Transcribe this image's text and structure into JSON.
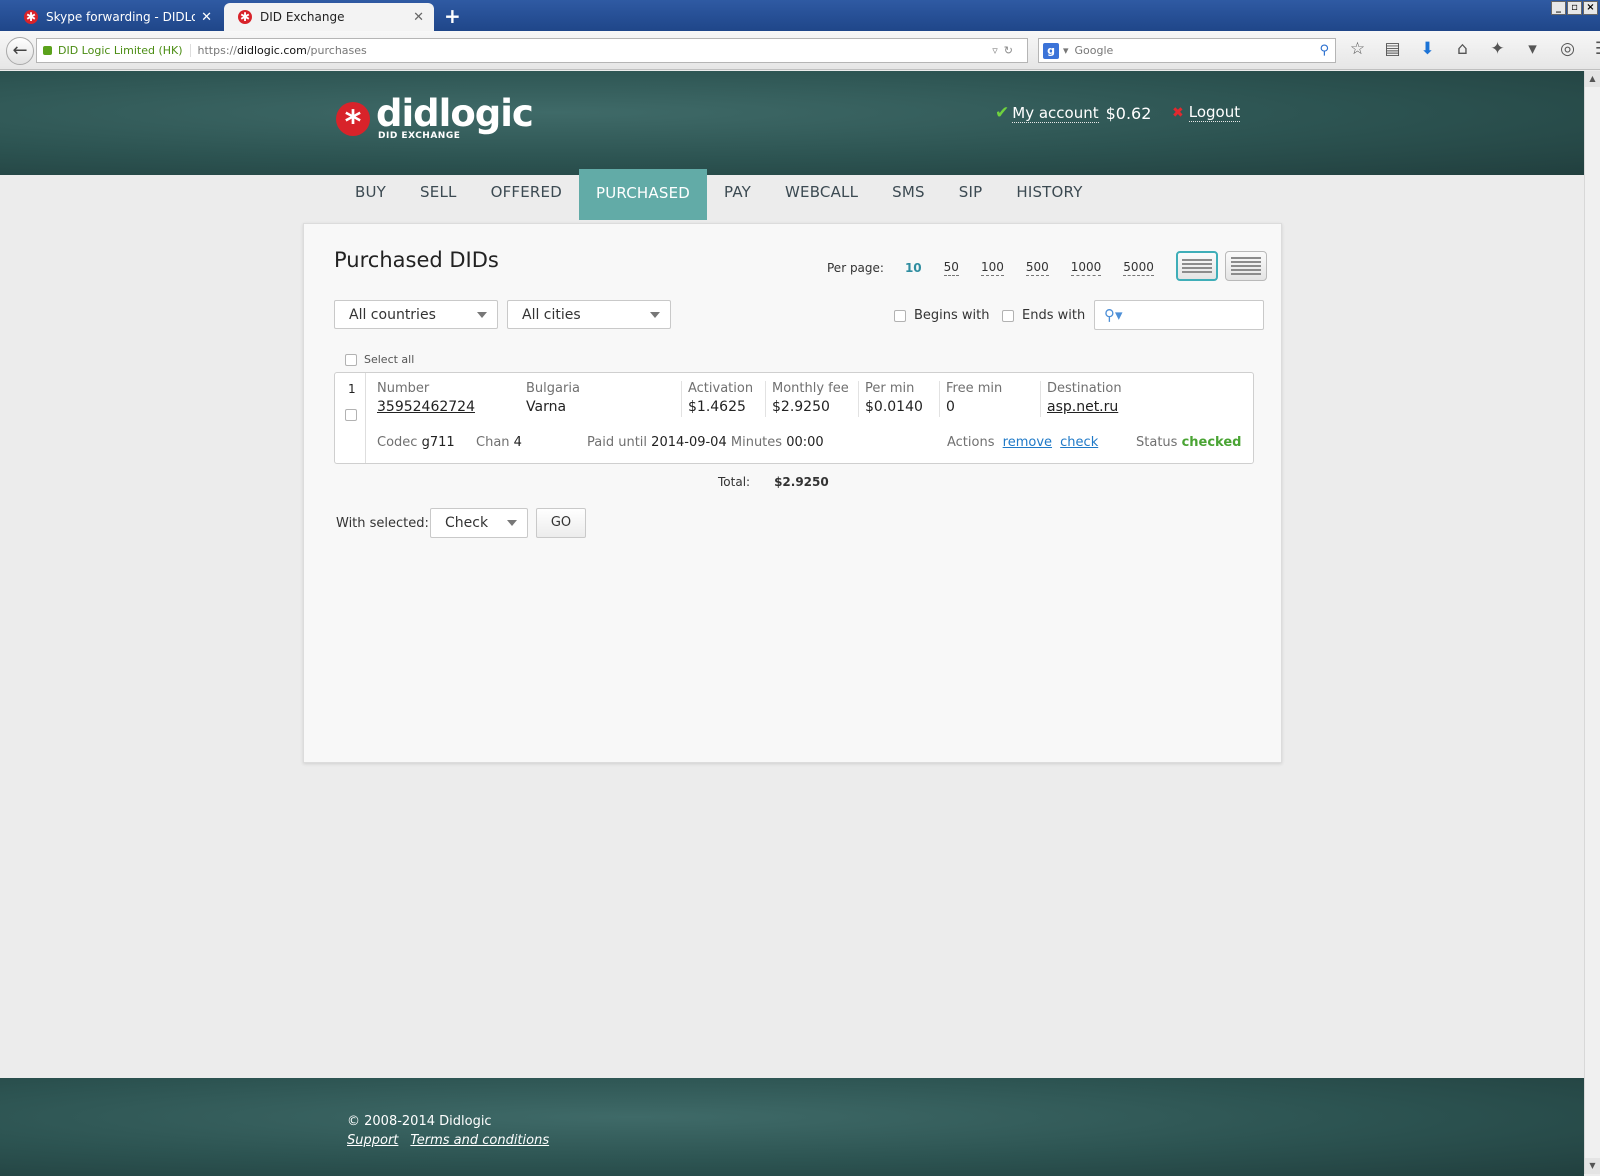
{
  "browser": {
    "tabs": [
      {
        "title": "Skype forwarding - DIDLogic",
        "active": false
      },
      {
        "title": "DID Exchange",
        "active": true
      }
    ],
    "new_tab": "+",
    "identity": "DID Logic Limited (HK)",
    "url_prefix": "https://",
    "url_domain": "didlogic.com",
    "url_path": "/purchases",
    "search_engine_letter": "g",
    "search_placeholder": "Google",
    "window_controls": [
      "_",
      "▫",
      "×"
    ]
  },
  "header": {
    "logo_mark": "*",
    "logo_name": "didlogic",
    "logo_sub": "DID EXCHANGE",
    "account_label": "My account",
    "balance": "$0.62",
    "logout_label": "Logout"
  },
  "nav": {
    "items": [
      "BUY",
      "SELL",
      "OFFERED",
      "PURCHASED",
      "PAY",
      "WEBCALL",
      "SMS",
      "SIP",
      "HISTORY"
    ],
    "active": "PURCHASED"
  },
  "panel": {
    "title": "Purchased DIDs",
    "per_page_label": "Per page:",
    "per_page_options": [
      "10",
      "50",
      "100",
      "500",
      "1000",
      "5000"
    ],
    "per_page_current": "10",
    "country_select": "All countries",
    "city_select": "All cities",
    "begins_with": "Begins with",
    "ends_with": "Ends with",
    "select_all": "Select all",
    "rows": [
      {
        "index": "1",
        "number_label": "Number",
        "number": "35952462724",
        "country": "Bulgaria",
        "city": "Varna",
        "activation_label": "Activation",
        "activation": "$1.4625",
        "monthly_label": "Monthly fee",
        "monthly": "$2.9250",
        "permin_label": "Per min",
        "permin": "$0.0140",
        "freemin_label": "Free min",
        "freemin": "0",
        "destination_label": "Destination",
        "destination": "asp.net.ru",
        "codec_label": "Codec",
        "codec": "g711",
        "chan_label": "Chan",
        "chan": "4",
        "paid_label": "Paid until",
        "paid_until": "2014-09-04",
        "minutes_label": "Minutes",
        "minutes": "00:00",
        "actions_label": "Actions",
        "action_remove": "remove",
        "action_check": "check",
        "status_label": "Status",
        "status": "checked"
      }
    ],
    "total_label": "Total:",
    "total": "$2.9250",
    "with_selected_label": "With selected:",
    "with_selected_value": "Check",
    "go_label": "GO"
  },
  "footer": {
    "copyright": "© 2008-2014 Didlogic",
    "links": [
      "Support",
      "Terms and conditions"
    ]
  },
  "colors": {
    "accent_teal": "#62aba7",
    "header_bg": "#2c5351",
    "brand_red": "#d8232a",
    "link_blue": "#1f79c7",
    "status_green": "#4aa434"
  }
}
